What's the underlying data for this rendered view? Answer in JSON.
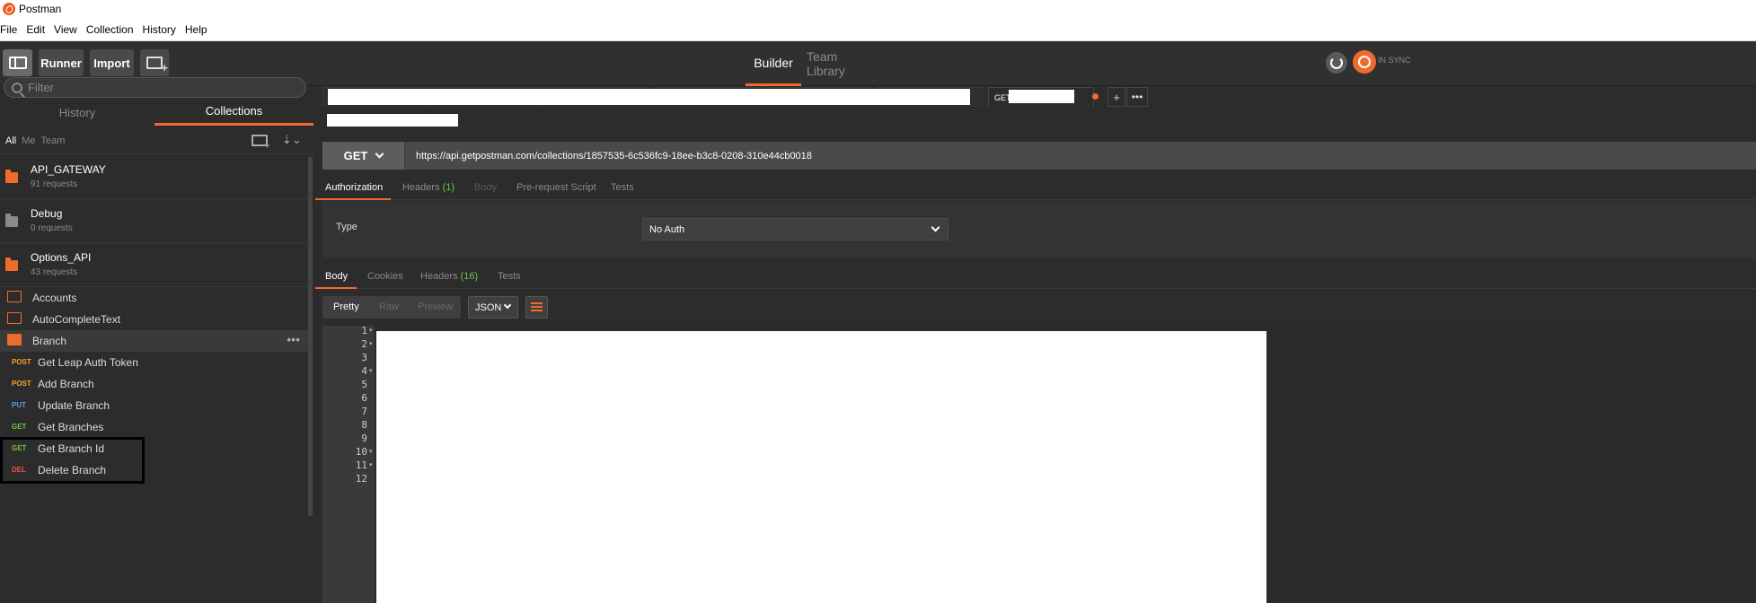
{
  "window": {
    "title": "Postman"
  },
  "menu": [
    "File",
    "Edit",
    "View",
    "Collection",
    "History",
    "Help"
  ],
  "toolbar": {
    "runner": "Runner",
    "import": "Import",
    "builder": "Builder",
    "library": "Team Library",
    "sync": "IN SYNC"
  },
  "sidebar": {
    "filter_placeholder": "Filter",
    "tabs": {
      "history": "History",
      "collections": "Collections"
    },
    "filters": [
      "All",
      "Me",
      "Team"
    ],
    "collections": [
      {
        "name": "API_GATEWAY",
        "count": "91 requests",
        "color": "#ef6b2c"
      },
      {
        "name": "Debug",
        "count": "0 requests",
        "color": "#8a8a8a"
      },
      {
        "name": "Options_API",
        "count": "43 requests",
        "color": "#ef6b2c"
      }
    ],
    "folders": [
      "Accounts",
      "AutoCompleteText",
      "Branch"
    ],
    "requests": [
      {
        "method": "POST",
        "name": "Get Leap Auth Token"
      },
      {
        "method": "POST",
        "name": "Add Branch"
      },
      {
        "method": "PUT",
        "name": "Update Branch"
      },
      {
        "method": "GET",
        "name": "Get Branches"
      },
      {
        "method": "GET",
        "name": "Get Branch Id"
      },
      {
        "method": "DEL",
        "name": "Delete Branch"
      }
    ]
  },
  "main": {
    "active_tab_method": "GET",
    "method": "GET",
    "url": "https://api.getpostman.com/collections/1857535-6c536fc9-18ee-b3c8-0208-310e44cb0018",
    "request_tabs": {
      "authorization": "Authorization",
      "headers": "Headers",
      "headers_count": "(1)",
      "body": "Body",
      "prerequest": "Pre-request Script",
      "tests": "Tests"
    },
    "auth": {
      "type_label": "Type",
      "type_value": "No Auth"
    },
    "response_tabs": {
      "body": "Body",
      "cookies": "Cookies",
      "headers": "Headers",
      "headers_count": "(16)",
      "tests": "Tests"
    },
    "view": {
      "pretty": "Pretty",
      "raw": "Raw",
      "preview": "Preview",
      "format": "JSON"
    },
    "line_numbers": [
      "1",
      "2",
      "3",
      "4",
      "5",
      "6",
      "7",
      "8",
      "9",
      "10",
      "11",
      "12"
    ]
  }
}
